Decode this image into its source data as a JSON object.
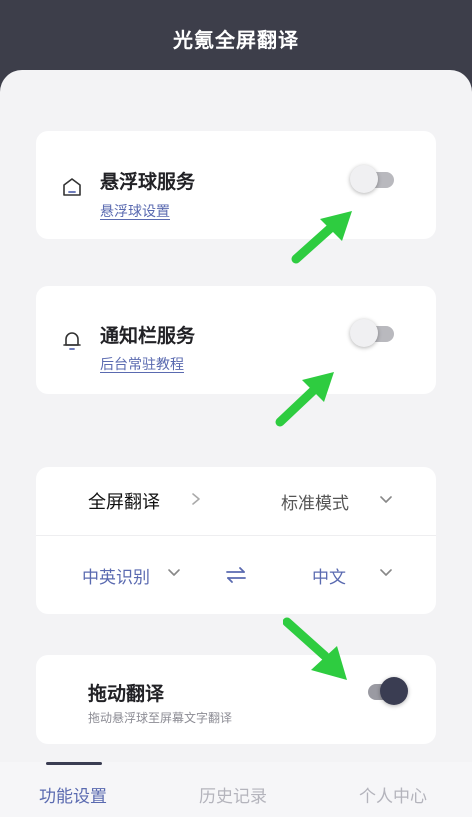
{
  "header": {
    "title": "光氪全屏翻译"
  },
  "services": [
    {
      "title": "悬浮球服务",
      "link": "悬浮球设置",
      "icon": "home-icon",
      "enabled": false
    },
    {
      "title": "通知栏服务",
      "link": "后台常驻教程",
      "icon": "bell-icon",
      "enabled": false
    }
  ],
  "fullscreen": {
    "label": "全屏翻译",
    "mode": "标准模式",
    "source_lang": "中英识别",
    "target_lang": "中文"
  },
  "drag": {
    "title": "拖动翻译",
    "description": "拖动悬浮球至屏幕文字翻译",
    "enabled": true
  },
  "tabs": [
    {
      "label": "功能设置",
      "active": true
    },
    {
      "label": "历史记录",
      "active": false
    },
    {
      "label": "个人中心",
      "active": false
    }
  ],
  "colors": {
    "header_bg": "#3d3e4a",
    "accent": "#5a6ab0",
    "toggle_on": "#3a3d52",
    "annotation_arrow": "#2ecc40"
  }
}
